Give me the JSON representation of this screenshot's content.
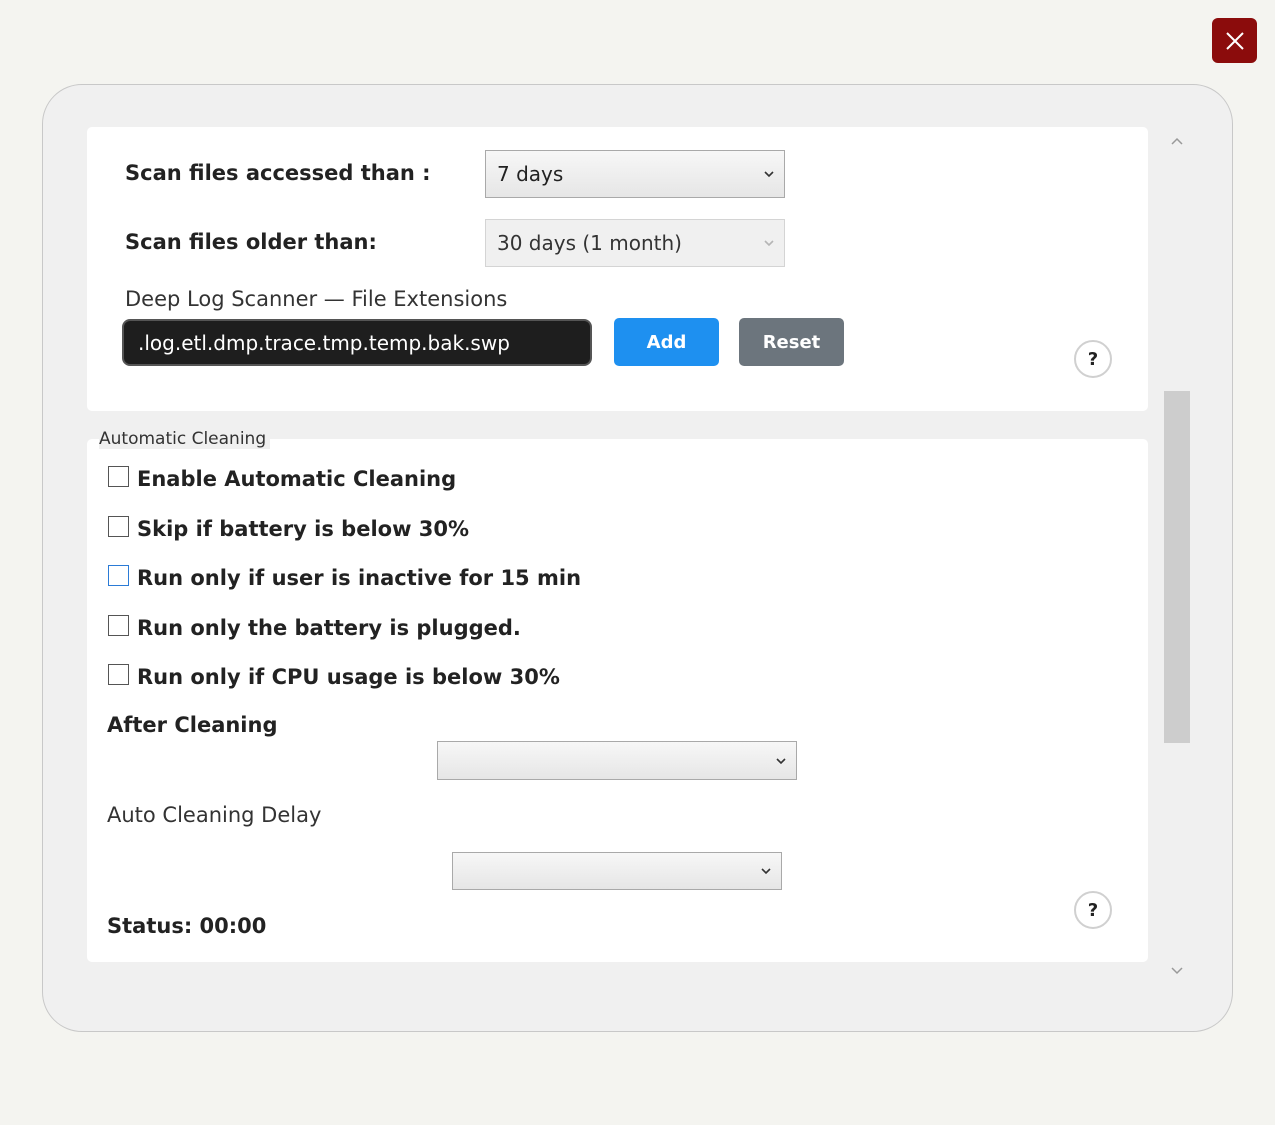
{
  "scan": {
    "accessed_label": "Scan files accessed than :",
    "accessed_value": "7 days",
    "older_label": "Scan files older than:",
    "older_value": "30 days (1 month)"
  },
  "deep_log": {
    "title": "Deep Log Scanner — File Extensions",
    "extensions_value": ".log.etl.dmp.trace.tmp.temp.bak.swp",
    "add_label": "Add",
    "reset_label": "Reset",
    "help_label": "?"
  },
  "auto_cleaning": {
    "group_title": "Automatic Cleaning",
    "options": [
      {
        "label": "Enable Automatic Cleaning",
        "checked": false
      },
      {
        "label": "Skip if battery is below 30%",
        "checked": false
      },
      {
        "label": "Run only if user is inactive for 15 min",
        "checked": false
      },
      {
        "label": "Run only the battery is plugged.",
        "checked": false
      },
      {
        "label": "Run only if CPU usage is below 30%",
        "checked": false
      }
    ],
    "after_cleaning_label": "After Cleaning",
    "after_cleaning_value": "",
    "delay_label": "Auto Cleaning Delay",
    "delay_value": "",
    "status_text": "Status: 00:00",
    "help_label": "?"
  },
  "colors": {
    "close_button": "#8b0c0c",
    "add_button": "#1e90f0",
    "reset_button": "#6c757d",
    "extensions_input_bg": "#1e1e1e"
  },
  "icons": {
    "close": "close-icon",
    "chevron": "chevron-down-icon",
    "scroll_up": "chevron-up-icon",
    "scroll_down": "chevron-down-icon"
  }
}
